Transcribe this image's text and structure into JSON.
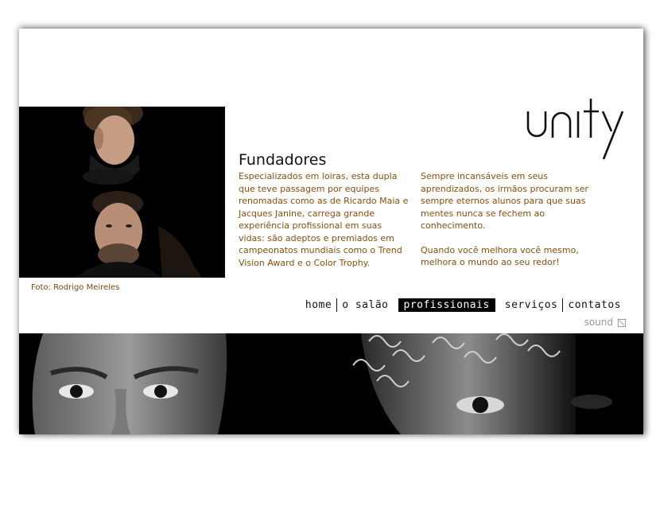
{
  "brand": {
    "logo_text": "unity"
  },
  "photo_credit": "Foto: Rodrigo Meireles",
  "title": "Fundadores",
  "column_left": [
    "Especializados em loiras, esta dupla que teve passagem por equipes renomadas como as de Ricardo Maia e Jacques Janine, carrega grande experiência profissional em suas vidas: são adeptos e premiados em campeonatos mundiais como o Trend Vision Award e o Color Trophy."
  ],
  "column_right": [
    "Sempre incansáveis em seus aprendizados, os irmãos procuram ser sempre eternos alunos para que suas mentes nunca se fechem ao conhecimento.",
    "Quando você melhora você mesmo, melhora o mundo ao seu redor!"
  ],
  "nav": {
    "items": [
      {
        "label": "home"
      },
      {
        "label": "o salão"
      },
      {
        "label": "profissionais"
      },
      {
        "label": "serviços"
      },
      {
        "label": "contatos"
      }
    ],
    "active": "profissionais"
  },
  "sound": {
    "label": "sound",
    "icon": "sound-toggle-icon"
  },
  "colors": {
    "text_brown": "#8a4e0c",
    "credit_brown": "#7a4d12",
    "title": "#111111",
    "nav_active_bg": "#000000",
    "sound_gray": "#9a9a9a"
  }
}
